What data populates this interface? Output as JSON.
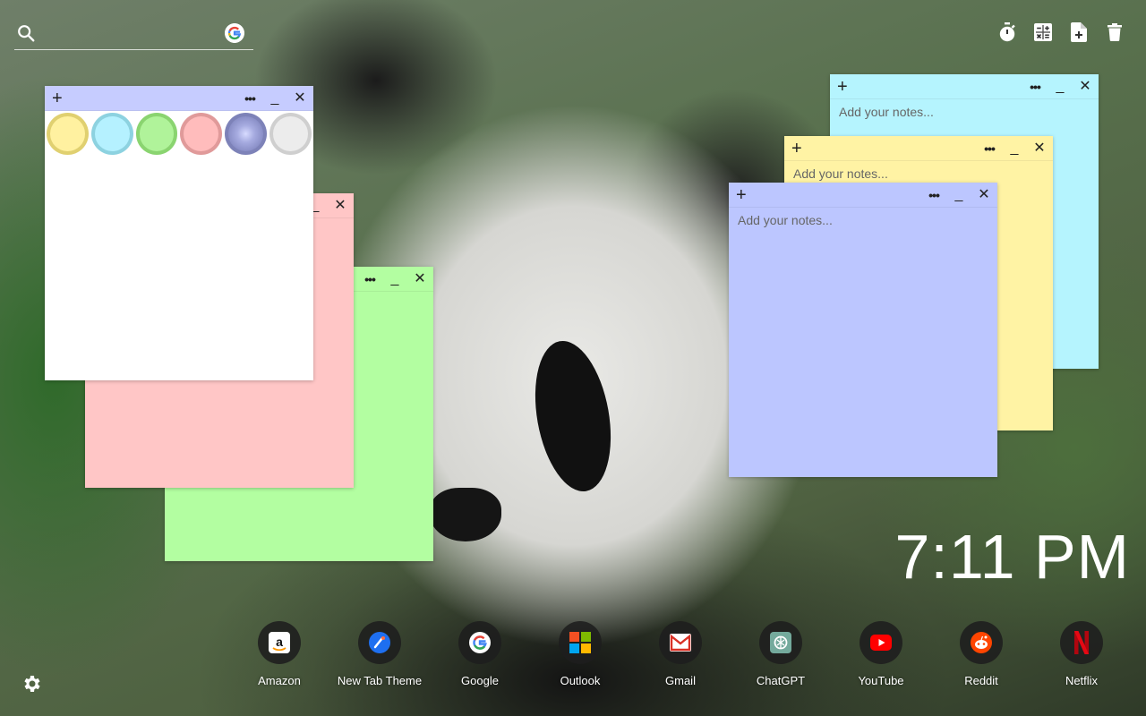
{
  "search": {
    "placeholder": "",
    "value": "",
    "icon": "search-icon",
    "engine_icon": "google-icon"
  },
  "toolbar": {
    "buttons": [
      {
        "icon": "timer-icon"
      },
      {
        "icon": "calculator-icon"
      },
      {
        "icon": "new-note-icon"
      },
      {
        "icon": "trash-icon"
      }
    ]
  },
  "notes": {
    "green": {
      "color": "#b3fea1",
      "add_label": "+",
      "more_label": "•••",
      "minimize_label": "_",
      "close_label": "✕"
    },
    "pink": {
      "color": "#ffc6c6",
      "add_label": "+",
      "more_label": "•••",
      "minimize_label": "_",
      "close_label": "✕"
    },
    "white": {
      "color": "#ffffff",
      "header_color": "#c6ccff",
      "add_label": "+",
      "more_label": "•••",
      "minimize_label": "_",
      "close_label": "✕",
      "swatches": [
        "#fff1a0",
        "#b5f1ff",
        "#b0f39a",
        "#ffbcbc",
        "#a6abe0",
        "#ececec"
      ]
    },
    "cyan": {
      "color": "#b5f4fe",
      "add_label": "+",
      "more_label": "•••",
      "minimize_label": "_",
      "close_label": "✕",
      "placeholder": "Add your notes..."
    },
    "yellow": {
      "color": "#fff3a4",
      "add_label": "+",
      "more_label": "•••",
      "minimize_label": "_",
      "close_label": "✕",
      "placeholder": "Add your notes..."
    },
    "blue": {
      "color": "#bcc6ff",
      "add_label": "+",
      "more_label": "•••",
      "minimize_label": "_",
      "close_label": "✕",
      "placeholder": "Add your notes..."
    }
  },
  "clock": {
    "time": "7:11 PM"
  },
  "dock": {
    "apps": [
      {
        "label": "Amazon",
        "icon": "amazon-icon"
      },
      {
        "label": "New Tab Theme",
        "icon": "new-tab-theme-icon"
      },
      {
        "label": "Google",
        "icon": "google-icon"
      },
      {
        "label": "Outlook",
        "icon": "outlook-icon"
      },
      {
        "label": "Gmail",
        "icon": "gmail-icon"
      },
      {
        "label": "ChatGPT",
        "icon": "chatgpt-icon"
      },
      {
        "label": "YouTube",
        "icon": "youtube-icon"
      },
      {
        "label": "Reddit",
        "icon": "reddit-icon"
      },
      {
        "label": "Netflix",
        "icon": "netflix-icon"
      }
    ]
  },
  "settings": {
    "icon": "gear-icon"
  }
}
